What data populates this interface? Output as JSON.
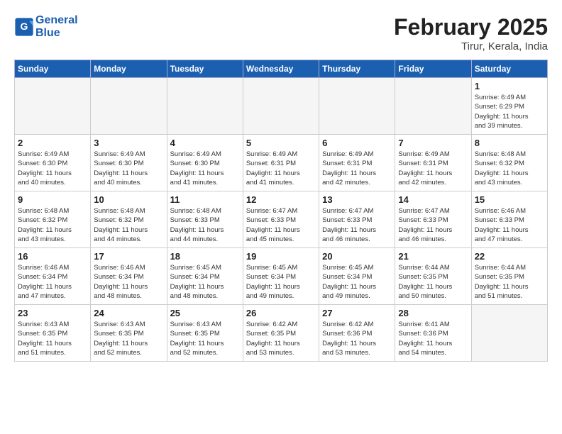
{
  "header": {
    "logo_line1": "General",
    "logo_line2": "Blue",
    "month_title": "February 2025",
    "location": "Tirur, Kerala, India"
  },
  "weekdays": [
    "Sunday",
    "Monday",
    "Tuesday",
    "Wednesday",
    "Thursday",
    "Friday",
    "Saturday"
  ],
  "weeks": [
    [
      {
        "day": "",
        "info": ""
      },
      {
        "day": "",
        "info": ""
      },
      {
        "day": "",
        "info": ""
      },
      {
        "day": "",
        "info": ""
      },
      {
        "day": "",
        "info": ""
      },
      {
        "day": "",
        "info": ""
      },
      {
        "day": "1",
        "info": "Sunrise: 6:49 AM\nSunset: 6:29 PM\nDaylight: 11 hours\nand 39 minutes."
      }
    ],
    [
      {
        "day": "2",
        "info": "Sunrise: 6:49 AM\nSunset: 6:30 PM\nDaylight: 11 hours\nand 40 minutes."
      },
      {
        "day": "3",
        "info": "Sunrise: 6:49 AM\nSunset: 6:30 PM\nDaylight: 11 hours\nand 40 minutes."
      },
      {
        "day": "4",
        "info": "Sunrise: 6:49 AM\nSunset: 6:30 PM\nDaylight: 11 hours\nand 41 minutes."
      },
      {
        "day": "5",
        "info": "Sunrise: 6:49 AM\nSunset: 6:31 PM\nDaylight: 11 hours\nand 41 minutes."
      },
      {
        "day": "6",
        "info": "Sunrise: 6:49 AM\nSunset: 6:31 PM\nDaylight: 11 hours\nand 42 minutes."
      },
      {
        "day": "7",
        "info": "Sunrise: 6:49 AM\nSunset: 6:31 PM\nDaylight: 11 hours\nand 42 minutes."
      },
      {
        "day": "8",
        "info": "Sunrise: 6:48 AM\nSunset: 6:32 PM\nDaylight: 11 hours\nand 43 minutes."
      }
    ],
    [
      {
        "day": "9",
        "info": "Sunrise: 6:48 AM\nSunset: 6:32 PM\nDaylight: 11 hours\nand 43 minutes."
      },
      {
        "day": "10",
        "info": "Sunrise: 6:48 AM\nSunset: 6:32 PM\nDaylight: 11 hours\nand 44 minutes."
      },
      {
        "day": "11",
        "info": "Sunrise: 6:48 AM\nSunset: 6:33 PM\nDaylight: 11 hours\nand 44 minutes."
      },
      {
        "day": "12",
        "info": "Sunrise: 6:47 AM\nSunset: 6:33 PM\nDaylight: 11 hours\nand 45 minutes."
      },
      {
        "day": "13",
        "info": "Sunrise: 6:47 AM\nSunset: 6:33 PM\nDaylight: 11 hours\nand 46 minutes."
      },
      {
        "day": "14",
        "info": "Sunrise: 6:47 AM\nSunset: 6:33 PM\nDaylight: 11 hours\nand 46 minutes."
      },
      {
        "day": "15",
        "info": "Sunrise: 6:46 AM\nSunset: 6:33 PM\nDaylight: 11 hours\nand 47 minutes."
      }
    ],
    [
      {
        "day": "16",
        "info": "Sunrise: 6:46 AM\nSunset: 6:34 PM\nDaylight: 11 hours\nand 47 minutes."
      },
      {
        "day": "17",
        "info": "Sunrise: 6:46 AM\nSunset: 6:34 PM\nDaylight: 11 hours\nand 48 minutes."
      },
      {
        "day": "18",
        "info": "Sunrise: 6:45 AM\nSunset: 6:34 PM\nDaylight: 11 hours\nand 48 minutes."
      },
      {
        "day": "19",
        "info": "Sunrise: 6:45 AM\nSunset: 6:34 PM\nDaylight: 11 hours\nand 49 minutes."
      },
      {
        "day": "20",
        "info": "Sunrise: 6:45 AM\nSunset: 6:34 PM\nDaylight: 11 hours\nand 49 minutes."
      },
      {
        "day": "21",
        "info": "Sunrise: 6:44 AM\nSunset: 6:35 PM\nDaylight: 11 hours\nand 50 minutes."
      },
      {
        "day": "22",
        "info": "Sunrise: 6:44 AM\nSunset: 6:35 PM\nDaylight: 11 hours\nand 51 minutes."
      }
    ],
    [
      {
        "day": "23",
        "info": "Sunrise: 6:43 AM\nSunset: 6:35 PM\nDaylight: 11 hours\nand 51 minutes."
      },
      {
        "day": "24",
        "info": "Sunrise: 6:43 AM\nSunset: 6:35 PM\nDaylight: 11 hours\nand 52 minutes."
      },
      {
        "day": "25",
        "info": "Sunrise: 6:43 AM\nSunset: 6:35 PM\nDaylight: 11 hours\nand 52 minutes."
      },
      {
        "day": "26",
        "info": "Sunrise: 6:42 AM\nSunset: 6:35 PM\nDaylight: 11 hours\nand 53 minutes."
      },
      {
        "day": "27",
        "info": "Sunrise: 6:42 AM\nSunset: 6:36 PM\nDaylight: 11 hours\nand 53 minutes."
      },
      {
        "day": "28",
        "info": "Sunrise: 6:41 AM\nSunset: 6:36 PM\nDaylight: 11 hours\nand 54 minutes."
      },
      {
        "day": "",
        "info": ""
      }
    ]
  ]
}
